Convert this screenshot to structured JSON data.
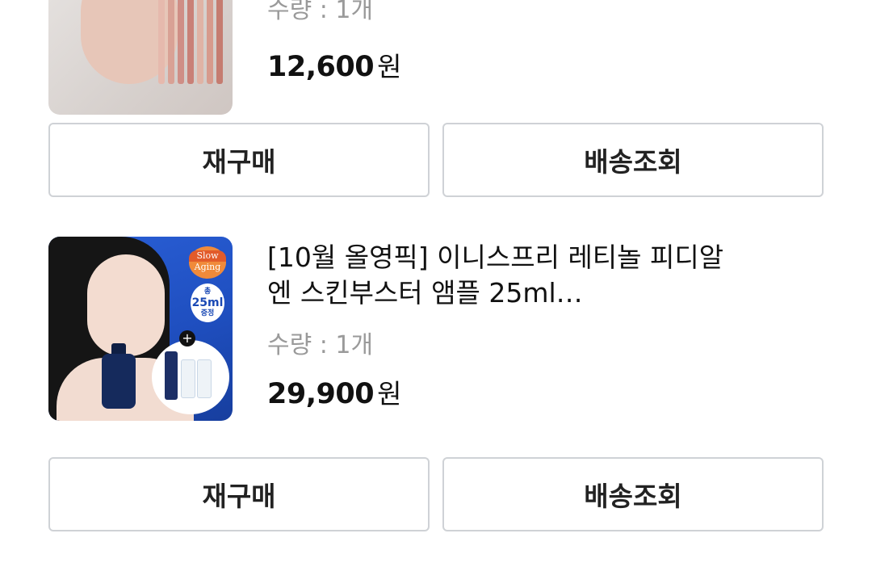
{
  "orders": [
    {
      "title": "",
      "quantity": "수량 : 1개",
      "price": "12,600",
      "currency": "원",
      "actions": {
        "rebuy": "재구매",
        "track": "배송조회"
      },
      "image_icon": "lip-tint-product-image"
    },
    {
      "title": "[10월 올영픽] 이니스프리 레티놀 피디알엔 스킨부스터 앰플 25ml…",
      "quantity": "수량 : 1개",
      "price": "29,900",
      "currency": "원",
      "actions": {
        "rebuy": "재구매",
        "track": "배송조회"
      },
      "image_icon": "retinol-ampoule-product-image",
      "image_badges": {
        "slow": "Slow",
        "aging": "Aging",
        "total": "총",
        "volume": "25ml",
        "gift": "증정"
      }
    }
  ]
}
